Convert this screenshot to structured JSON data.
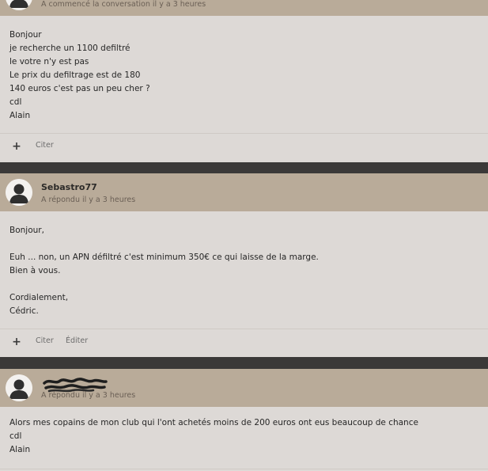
{
  "posts": [
    {
      "meta": "A commencé la conversation il y a 3 heures",
      "lines": [
        "Bonjour",
        "je recherche un 1100 defiltré",
        "le votre n'y est pas",
        "Le prix du defiltrage est de 180",
        "140 euros c'est pas un peu cher ?",
        "cdl",
        "Alain"
      ],
      "actions": [
        "Citer"
      ]
    },
    {
      "author": "Sebastro77",
      "meta": "A répondu il y a 3 heures",
      "lines": [
        "Bonjour,",
        "",
        "Euh ... non, un APN défiltré c'est minimum 350€ ce qui laisse de la marge.",
        "Bien à vous.",
        "",
        "Cordialement,",
        "Cédric."
      ],
      "actions": [
        "Citer",
        "Éditer"
      ]
    },
    {
      "meta": "A répondu il y a 3 heures",
      "lines": [
        "Alors mes copains de mon club qui l'ont achetés moins de 200 euros ont eus beaucoup de chance",
        "cdl",
        "Alain"
      ]
    }
  ],
  "plus_symbol": "+"
}
